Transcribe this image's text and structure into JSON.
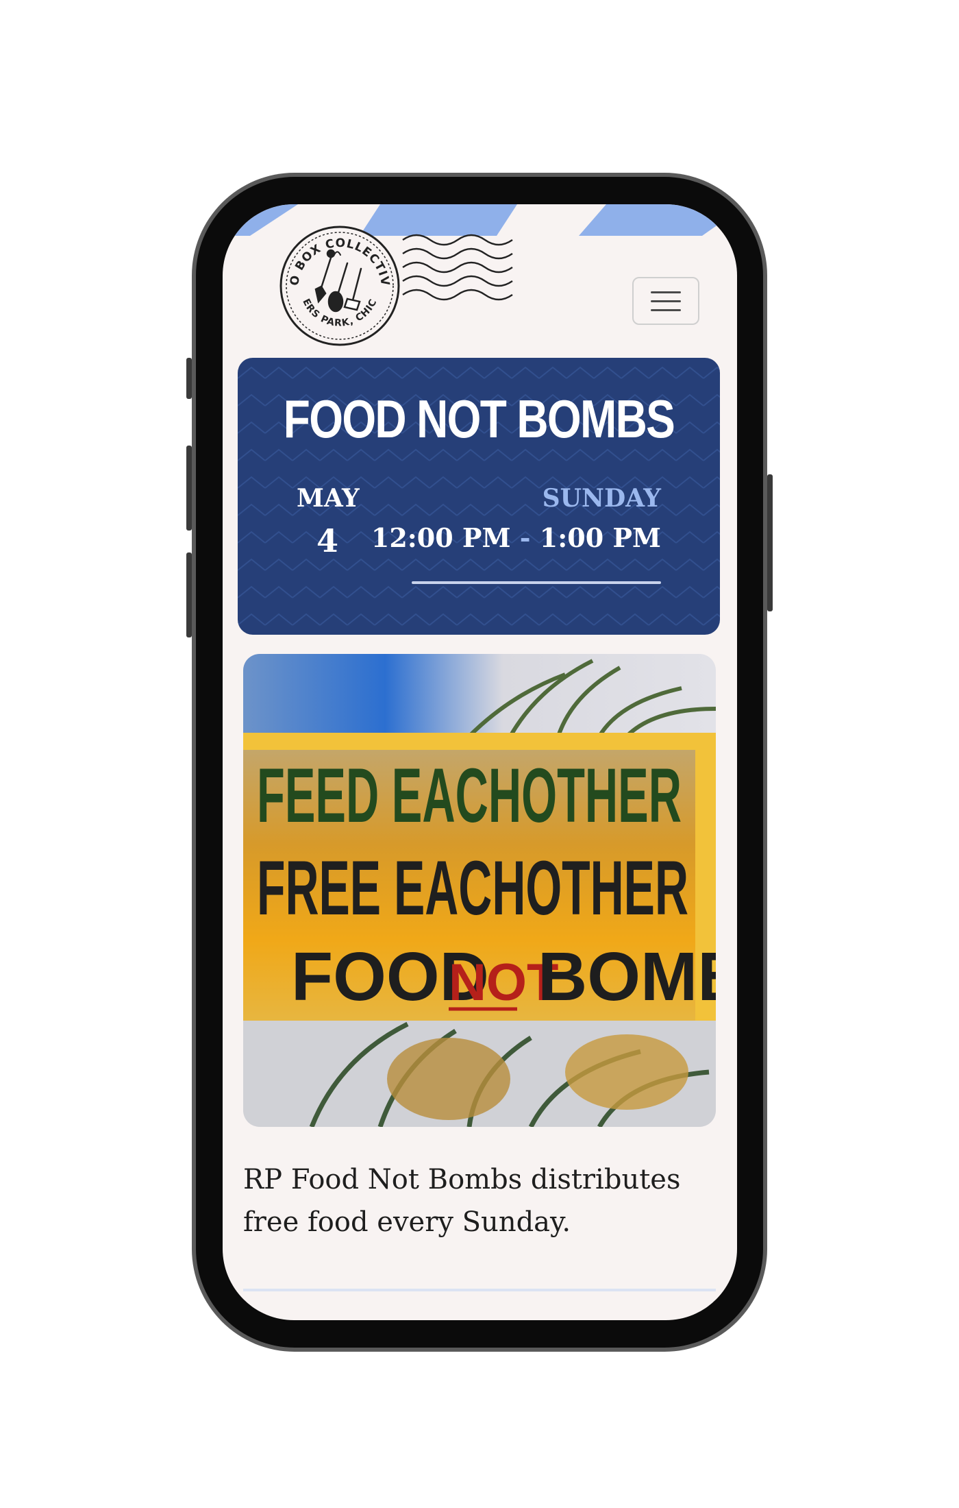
{
  "header": {
    "logo": {
      "text_top": "PO BOX COLLECTIVE",
      "text_bottom": "ROGERS PARK, CHICAGO",
      "icon": "garden-tools-stamp-icon"
    },
    "menu_icon": "hamburger-menu-icon"
  },
  "event": {
    "title": "FOOD NOT BOMBS",
    "month": "MAY",
    "day": "4",
    "weekday": "SUNDAY",
    "start_time": "12:00 PM",
    "separator": "-",
    "end_time": "1:00 PM"
  },
  "photo": {
    "sign_line1": "FEED EACHOTHER",
    "sign_line2": "FREE EACHOTHER",
    "sign_line3_a": "FOOD",
    "sign_line3_b": "NOT",
    "sign_line3_c": "BOMBS"
  },
  "description": "RP Food Not Bombs distributes free food every Sunday.",
  "colors": {
    "card_bg": "#263f78",
    "accent_light_blue": "#9bb8ee",
    "stripe_blue": "#8fb0ea",
    "page_bg": "#f8f3f2"
  }
}
